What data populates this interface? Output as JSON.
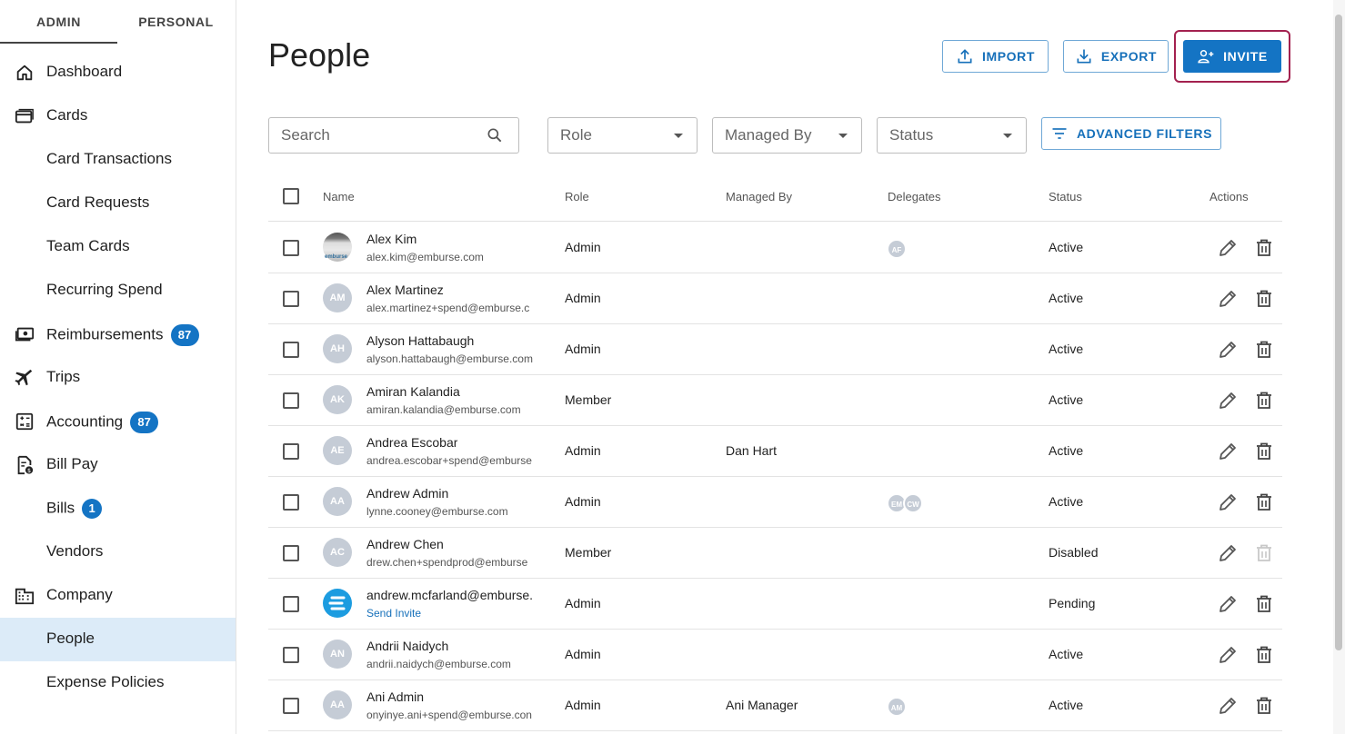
{
  "mode_tabs": [
    "ADMIN",
    "PERSONAL"
  ],
  "nav": {
    "dashboard": "Dashboard",
    "cards": "Cards",
    "card_transactions": "Card Transactions",
    "card_requests": "Card Requests",
    "team_cards": "Team Cards",
    "recurring_spend": "Recurring Spend",
    "reimbursements": "Reimbursements",
    "reimbursements_badge": "87",
    "trips": "Trips",
    "accounting": "Accounting",
    "accounting_badge": "87",
    "bill_pay": "Bill Pay",
    "bills": "Bills",
    "bills_badge": "1",
    "vendors": "Vendors",
    "company": "Company",
    "people": "People",
    "expense_policies": "Expense Policies"
  },
  "page": {
    "title": "People",
    "import_label": "IMPORT",
    "export_label": "EXPORT",
    "invite_label": "INVITE"
  },
  "filters": {
    "search_placeholder": "Search",
    "role": "Role",
    "managed_by": "Managed By",
    "status": "Status",
    "advanced": "ADVANCED FILTERS"
  },
  "table": {
    "headers": [
      "Name",
      "Role",
      "Managed By",
      "Delegates",
      "Status",
      "Actions"
    ],
    "rows": [
      {
        "initials": "",
        "name": "Alex Kim",
        "email": "alex.kim@emburse.com",
        "role": "Admin",
        "managed_by": "",
        "delegates": [
          "AF"
        ],
        "status": "Active"
      },
      {
        "initials": "AM",
        "name": "Alex Martinez",
        "email": "alex.martinez+spend@emburse.c",
        "role": "Admin",
        "managed_by": "",
        "delegates": [],
        "status": "Active"
      },
      {
        "initials": "AH",
        "name": "Alyson Hattabaugh",
        "email": "alyson.hattabaugh@emburse.com",
        "role": "Admin",
        "managed_by": "",
        "delegates": [],
        "status": "Active"
      },
      {
        "initials": "AK",
        "name": "Amiran Kalandia",
        "email": "amiran.kalandia@emburse.com",
        "role": "Member",
        "managed_by": "",
        "delegates": [],
        "status": "Active"
      },
      {
        "initials": "AE",
        "name": "Andrea Escobar",
        "email": "andrea.escobar+spend@emburse",
        "role": "Admin",
        "managed_by": "Dan Hart",
        "delegates": [],
        "status": "Active"
      },
      {
        "initials": "AA",
        "name": "Andrew Admin",
        "email": "lynne.cooney@emburse.com",
        "role": "Admin",
        "managed_by": "",
        "delegates": [
          "EM",
          "CW"
        ],
        "status": "Active"
      },
      {
        "initials": "AC",
        "name": "Andrew Chen",
        "email": "drew.chen+spendprod@emburse",
        "role": "Member",
        "managed_by": "",
        "delegates": [],
        "status": "Disabled"
      },
      {
        "initials": "",
        "name": "andrew.mcfarland@emburse.",
        "email": "Send Invite",
        "role": "Admin",
        "managed_by": "",
        "delegates": [],
        "status": "Pending"
      },
      {
        "initials": "AN",
        "name": "Andrii Naidych",
        "email": "andrii.naidych@emburse.com",
        "role": "Admin",
        "managed_by": "",
        "delegates": [],
        "status": "Active"
      },
      {
        "initials": "AA",
        "name": "Ani Admin",
        "email": "onyinye.ani+spend@emburse.con",
        "role": "Admin",
        "managed_by": "Ani Manager",
        "delegates": [
          "AM"
        ],
        "status": "Active"
      }
    ]
  },
  "avatar_photo_text": "emburse",
  "colors": {
    "primary": "#1474c4",
    "highlight_frame": "#a3214f",
    "active_nav_bg": "#dcebf8",
    "avatar_bg": "#c5ccd6"
  }
}
